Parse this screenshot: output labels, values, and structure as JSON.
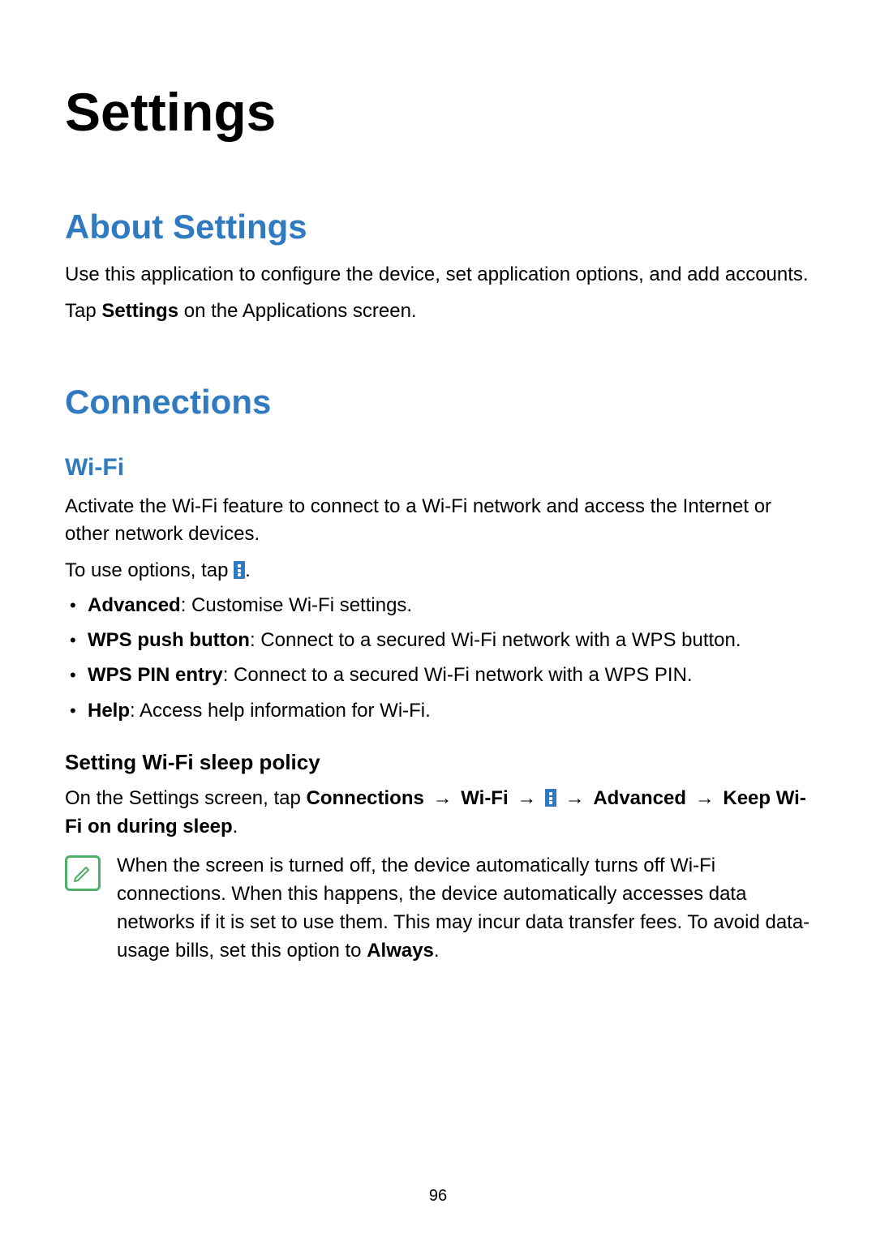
{
  "page_title": "Settings",
  "sections": {
    "about": {
      "heading": "About Settings",
      "p1": "Use this application to configure the device, set application options, and add accounts.",
      "p2_pre": "Tap ",
      "p2_bold": "Settings",
      "p2_post": " on the Applications screen."
    },
    "connections": {
      "heading": "Connections",
      "wifi": {
        "heading": "Wi-Fi",
        "p1": "Activate the Wi-Fi feature to connect to a Wi-Fi network and access the Internet or other network devices.",
        "p2_pre": "To use options, tap ",
        "p2_post": ".",
        "bullets": [
          {
            "label": "Advanced",
            "desc": ": Customise Wi-Fi settings."
          },
          {
            "label": "WPS push button",
            "desc": ": Connect to a secured Wi-Fi network with a WPS button."
          },
          {
            "label": "WPS PIN entry",
            "desc": ": Connect to a secured Wi-Fi network with a WPS PIN."
          },
          {
            "label": "Help",
            "desc": ": Access help information for Wi-Fi."
          }
        ],
        "sleep": {
          "heading": "Setting Wi-Fi sleep policy",
          "path_pre": "On the Settings screen, tap ",
          "seg1": "Connections",
          "arrow": " → ",
          "seg2": "Wi-Fi",
          "seg3": "Advanced",
          "seg4": "Keep Wi-Fi on during sleep",
          "path_post": ".",
          "note_text": "When the screen is turned off, the device automatically turns off Wi-Fi connections. When this happens, the device automatically accesses data networks if it is set to use them. This may incur data transfer fees. To avoid data-usage bills, set this option to ",
          "note_bold": "Always",
          "note_after": "."
        }
      }
    }
  },
  "page_number": "96"
}
